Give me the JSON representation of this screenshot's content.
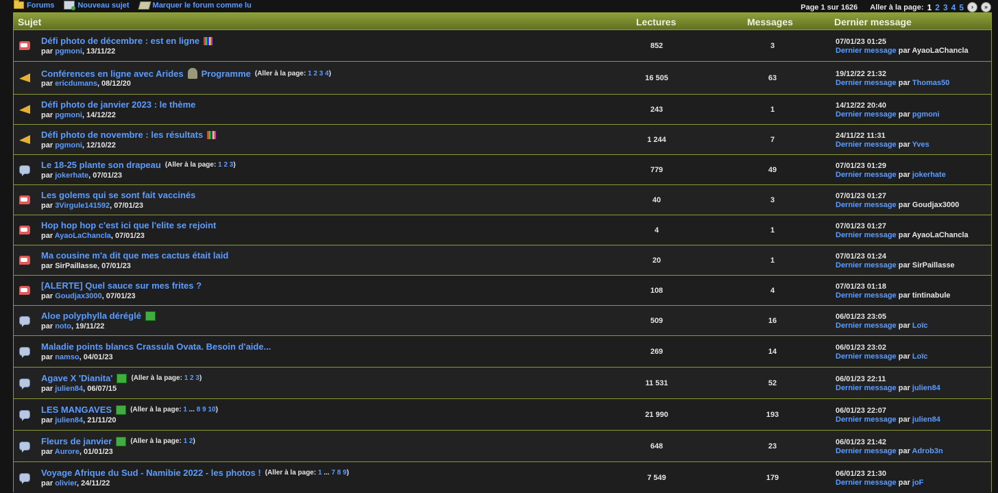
{
  "topnav": {
    "forums": "Forums",
    "new_topic": "Nouveau sujet",
    "mark_read": "Marquer le forum comme lu"
  },
  "pagination": {
    "label": "Page 1 sur 1626",
    "goto": "Aller à la page:",
    "current": "1",
    "pages": [
      "2",
      "3",
      "4",
      "5"
    ]
  },
  "headers": {
    "subject": "Sujet",
    "views": "Lectures",
    "replies": "Messages",
    "last": "Dernier message"
  },
  "common": {
    "by": "par",
    "last_link": "Dernier message",
    "goto": "(Aller à la page:"
  },
  "topics": [
    {
      "icon": "hot",
      "title": "Défi photo de décembre : est en ligne",
      "extra": "chart",
      "goto": [],
      "author": "pgmoni",
      "author_link": true,
      "date": "13/11/22",
      "views": "852",
      "replies": "3",
      "last_date": "07/01/23 01:25",
      "last_user": "AyaoLaChancla",
      "last_link": false
    },
    {
      "icon": "announce",
      "title": "Conférences en ligne avec Arides",
      "title2": "Programme",
      "extra": "cactus",
      "goto": [
        "1",
        "2",
        "3",
        "4"
      ],
      "author": "ericdumans",
      "author_link": true,
      "date": "08/12/20",
      "views": "16 505",
      "replies": "63",
      "last_date": "19/12/22 21:32",
      "last_user": "Thomas50",
      "last_link": true
    },
    {
      "icon": "announce",
      "title": "Défi photo de janvier 2023 : le thème",
      "extra": "",
      "goto": [],
      "author": "pgmoni",
      "author_link": true,
      "date": "14/12/22",
      "views": "243",
      "replies": "1",
      "last_date": "14/12/22 20:40",
      "last_user": "pgmoni",
      "last_link": true
    },
    {
      "icon": "announce",
      "title": "Défi photo de novembre : les résultats",
      "extra": "chart",
      "goto": [],
      "author": "pgmoni",
      "author_link": true,
      "date": "12/10/22",
      "views": "1 244",
      "replies": "7",
      "last_date": "24/11/22 11:31",
      "last_user": "Yves",
      "last_link": true
    },
    {
      "icon": "topic",
      "title": "Le 18-25 plante son drapeau",
      "extra": "",
      "goto": [
        "1",
        "2",
        "3"
      ],
      "author": "jokerhate",
      "author_link": true,
      "date": "07/01/23",
      "views": "779",
      "replies": "49",
      "last_date": "07/01/23 01:29",
      "last_user": "jokerhate",
      "last_link": true
    },
    {
      "icon": "hot",
      "title": "Les golems qui se sont fait vaccinés",
      "extra": "",
      "goto": [],
      "author": "3Virgule141592",
      "author_link": true,
      "date": "07/01/23",
      "views": "40",
      "replies": "3",
      "last_date": "07/01/23 01:27",
      "last_user": "Goudjax3000",
      "last_link": false
    },
    {
      "icon": "hot",
      "title": "Hop hop hop c'est ici que l'elite se rejoint",
      "extra": "",
      "goto": [],
      "author": "AyaoLaChancla",
      "author_link": true,
      "date": "07/01/23",
      "views": "4",
      "replies": "1",
      "last_date": "07/01/23 01:27",
      "last_user": "AyaoLaChancla",
      "last_link": false
    },
    {
      "icon": "hot",
      "title": "Ma cousine m'a dit que mes cactus était laid",
      "extra": "",
      "goto": [],
      "author": "SirPaillasse",
      "author_link": false,
      "date": "07/01/23",
      "views": "20",
      "replies": "1",
      "last_date": "07/01/23 01:24",
      "last_user": "SirPaillasse",
      "last_link": false
    },
    {
      "icon": "hot",
      "title": "[ALERTE] Quel sauce sur mes frites ?",
      "extra": "",
      "goto": [],
      "author": "Goudjax3000",
      "author_link": true,
      "date": "07/01/23",
      "views": "108",
      "replies": "4",
      "last_date": "07/01/23 01:18",
      "last_user": "tintinabule",
      "last_link": false
    },
    {
      "icon": "topic",
      "title": "Aloe polyphylla déréglé",
      "extra": "leaf",
      "goto": [],
      "author": "noto",
      "author_link": true,
      "date": "19/11/22",
      "views": "509",
      "replies": "16",
      "last_date": "06/01/23 23:05",
      "last_user": "Loïc",
      "last_link": true
    },
    {
      "icon": "topic",
      "title": "Maladie points blancs Crassula Ovata. Besoin d'aide...",
      "extra": "",
      "goto": [],
      "author": "namso",
      "author_link": true,
      "date": "04/01/23",
      "views": "269",
      "replies": "14",
      "last_date": "06/01/23 23:02",
      "last_user": "Loïc",
      "last_link": true
    },
    {
      "icon": "topic",
      "title": "Agave X 'Dianita'",
      "extra": "leaf",
      "goto": [
        "1",
        "2",
        "3"
      ],
      "author": "julien84",
      "author_link": true,
      "date": "06/07/15",
      "views": "11 531",
      "replies": "52",
      "last_date": "06/01/23 22:11",
      "last_user": "julien84",
      "last_link": true
    },
    {
      "icon": "topic",
      "title": "LES MANGAVES",
      "extra": "leaf",
      "goto": [
        "1",
        "...",
        "8",
        "9",
        "10"
      ],
      "author": "julien84",
      "author_link": true,
      "date": "21/11/20",
      "views": "21 990",
      "replies": "193",
      "last_date": "06/01/23 22:07",
      "last_user": "julien84",
      "last_link": true
    },
    {
      "icon": "topic",
      "title": "Fleurs de janvier",
      "extra": "leaf",
      "goto": [
        "1",
        "2"
      ],
      "author": "Aurore",
      "author_link": true,
      "date": "01/01/23",
      "views": "648",
      "replies": "23",
      "last_date": "06/01/23 21:42",
      "last_user": "Adrob3n",
      "last_link": true
    },
    {
      "icon": "topic",
      "title": "Voyage Afrique du Sud - Namibie 2022 - les photos !",
      "extra": "",
      "goto": [
        "1",
        "...",
        "7",
        "8",
        "9"
      ],
      "author": "olivier",
      "author_link": true,
      "date": "24/11/22",
      "views": "7 549",
      "replies": "179",
      "last_date": "06/01/23 21:30",
      "last_user": "joF",
      "last_link": true
    }
  ]
}
